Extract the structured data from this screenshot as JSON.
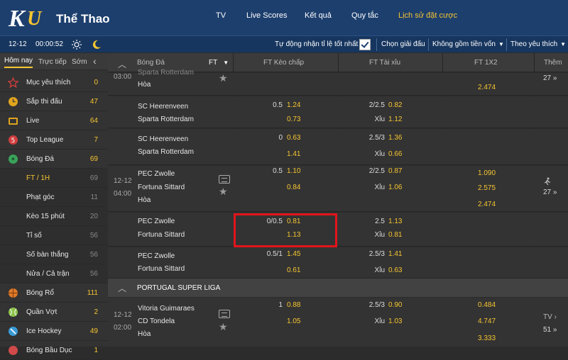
{
  "header": {
    "brand": "Thể Thao",
    "nav": [
      "TV",
      "Live Scores",
      "Kết quả",
      "Quy tắc",
      "Lịch sử đặt cược"
    ]
  },
  "subbar": {
    "date": "12-12",
    "time": "00:00:52",
    "auto_accept": "Tự động nhận tỉ lệ tốt nhất",
    "select_league": "Chọn giải đấu",
    "capital": "Không gồm tiền vốn",
    "sort": "Theo yêu thích"
  },
  "sidebar": {
    "tabs": [
      "Hôm nay",
      "Trực tiếp",
      "Sớm"
    ],
    "items": [
      {
        "label": "Mục yêu thích",
        "count": "0",
        "icon": "star-icon",
        "color": "#d13e3e"
      },
      {
        "label": "Sắp thi đấu",
        "count": "47",
        "icon": "clock-icon",
        "color": "#e0a41e"
      },
      {
        "label": "Live",
        "count": "64",
        "icon": "tv-icon",
        "color": "#e0a41e"
      },
      {
        "label": "Top League",
        "count": "7",
        "icon": "top-league-icon",
        "color": "#d13e3e"
      },
      {
        "label": "Bóng Đá",
        "count": "69",
        "icon": "soccer-ball-icon",
        "color": "#3aa25b"
      },
      {
        "label": "FT / 1H",
        "count": "69",
        "sub": true,
        "active": true
      },
      {
        "label": "Phạt góc",
        "count": "11",
        "sub": true
      },
      {
        "label": "Kèo 15 phút",
        "count": "20",
        "sub": true
      },
      {
        "label": "Tỉ số",
        "count": "56",
        "sub": true
      },
      {
        "label": "Số bàn thắng",
        "count": "56",
        "sub": true
      },
      {
        "label": "Nửa / Cả trận",
        "count": "56",
        "sub": true
      },
      {
        "label": "Bóng Rổ",
        "count": "111",
        "icon": "basketball-icon",
        "color": "#e07a28"
      },
      {
        "label": "Quần Vợt",
        "count": "2",
        "icon": "tennis-icon",
        "color": "#8bc34a"
      },
      {
        "label": "Ice Hockey",
        "count": "49",
        "icon": "ice-hockey-icon",
        "color": "#3a9bd6"
      },
      {
        "label": "Bóng Bầu Dục",
        "count": "1",
        "icon": "rugby-icon",
        "color": "#d04a4a"
      }
    ]
  },
  "table": {
    "headers": {
      "sport": "Bóng Đá",
      "period": "FT",
      "handicap": "FT Kèo chấp",
      "overunder": "FT Tài xỉu",
      "x12": "FT 1X2",
      "more": "Thêm"
    },
    "league2": "PORTUGAL SUPER LIGA"
  },
  "rows": {
    "r0": {
      "time": "03:00",
      "team_partial": "Sparta Rotterdam",
      "draw": "Hòa",
      "x12": "2.474",
      "more": "27"
    },
    "r1": {
      "home": "SC Heerenveen",
      "away": "Sparta Rotterdam",
      "hdp_line": "0.5",
      "hdp_home": "1.24",
      "hdp_away": "0.73",
      "ou_line": "2/2.5",
      "ou_over": "0.82",
      "ou_under_label": "Xỉu",
      "ou_under": "1.12"
    },
    "r2": {
      "home": "SC Heerenveen",
      "away": "Sparta Rotterdam",
      "hdp_line": "0",
      "hdp_home": "0.63",
      "hdp_away": "1.41",
      "ou_line": "2.5/3",
      "ou_over": "1.36",
      "ou_under_label": "Xỉu",
      "ou_under": "0.66"
    },
    "r3": {
      "date": "12-12",
      "time": "04:00",
      "home": "PEC Zwolle",
      "away": "Fortuna Sittard",
      "draw": "Hòa",
      "hdp_line": "0.5",
      "hdp_home": "1.10",
      "hdp_away": "0.84",
      "ou_line": "2/2.5",
      "ou_over": "0.87",
      "ou_under_label": "Xỉu",
      "ou_under": "1.06",
      "x1": "1.090",
      "x2": "2.575",
      "xx": "2.474",
      "more": "27"
    },
    "r4": {
      "home": "PEC Zwolle",
      "away": "Fortuna Sittard",
      "hdp_line": "0/0.5",
      "hdp_home": "0.81",
      "hdp_away": "1.13",
      "ou_line": "2.5",
      "ou_over": "1.13",
      "ou_under_label": "Xỉu",
      "ou_under": "0.81"
    },
    "r5": {
      "home": "PEC Zwolle",
      "away": "Fortuna Sittard",
      "hdp_line": "0.5/1",
      "hdp_home": "1.45",
      "hdp_away": "0.61",
      "ou_line": "2.5/3",
      "ou_over": "1.41",
      "ou_under_label": "Xỉu",
      "ou_under": "0.63"
    },
    "r6": {
      "date": "12-12",
      "time": "02:00",
      "home": "Vitoria Guimaraes",
      "away": "CD Tondela",
      "draw": "Hòa",
      "hdp_line": "1",
      "hdp_home": "0.88",
      "hdp_away": "1.05",
      "ou_line": "2.5/3",
      "ou_over": "0.90",
      "ou_under_label": "Xỉu",
      "ou_under": "1.03",
      "x1": "0.484",
      "x2": "4.747",
      "xx": "3.333",
      "tv": "TV",
      "more": "51"
    }
  },
  "colors": {
    "header_bg": "#1d3f6e",
    "accent": "#f6c531",
    "highlight_box": "#e2141b"
  }
}
